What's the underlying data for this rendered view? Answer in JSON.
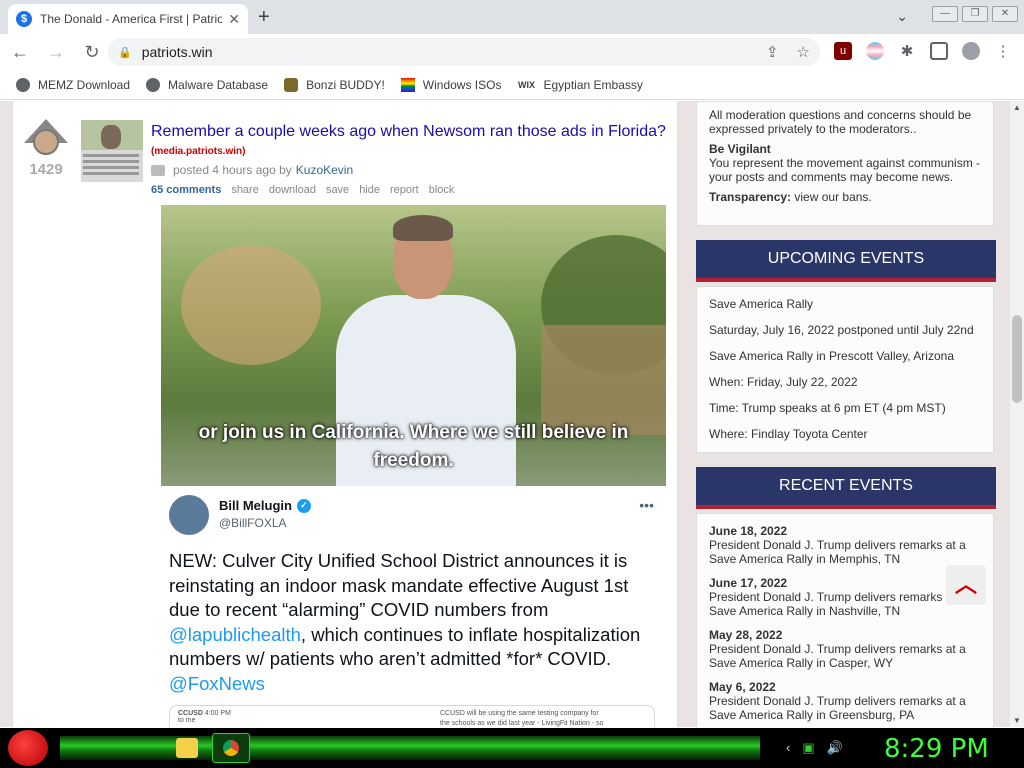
{
  "browser": {
    "tab_title": "The Donald - America First | Patriots",
    "favicon_glyph": "$",
    "close_glyph": "✕",
    "new_tab_glyph": "+",
    "url": "patriots.win"
  },
  "bookmarks": [
    {
      "label": "MEMZ Download"
    },
    {
      "label": "Malware Database"
    },
    {
      "label": "Bonzi BUDDY!"
    },
    {
      "label": "Windows ISOs"
    },
    {
      "label": "Egyptian Embassy",
      "icon_text": "WIX"
    }
  ],
  "post": {
    "score": "1429",
    "title": "Remember a couple weeks ago when Newsom ran those ads in Florida?",
    "domain": "(media.patriots.win)",
    "posted": "posted 4 hours ago by",
    "author": "KuzoKevin",
    "actions": {
      "comments": "65 comments",
      "share": "share",
      "download": "download",
      "save": "save",
      "hide": "hide",
      "report": "report",
      "block": "block"
    },
    "video_caption_1": "or join us in California. Where we still believe in",
    "video_caption_2": "freedom.",
    "tweet": {
      "name": "Bill Melugin",
      "handle": "@BillFOXLA",
      "text_1": "NEW: Culver City Unified School District announces it is reinstating an indoor mask mandate effective August 1st due to recent “alarming” COVID numbers from ",
      "link_1": "@lapublichealth",
      "text_2": ", which continues to inflate hospitalization numbers w/ patients who aren’t admitted *for* COVID. ",
      "link_2": "@FoxNews",
      "embed_sender": "CCUSD",
      "embed_time": "4:00 PM",
      "embed_to": "to me",
      "embed_line_1": "CCUSD will be using the same testing company for",
      "embed_line_2": "the schools as we did last year - LivingFit Nation - so"
    }
  },
  "sidebar": {
    "rules": {
      "moderation": "All moderation questions and concerns should be expressed privately to the moderators..",
      "vigilant_title": "Be Vigilant",
      "vigilant_text": "You represent the movement against communism - your posts and comments may become news.",
      "transparency_title": "Transparency:",
      "transparency_link": "view our bans."
    },
    "upcoming_title": "UPCOMING EVENTS",
    "upcoming": [
      "Save America Rally",
      "Saturday, July 16, 2022 postponed until July 22nd",
      "Save America Rally in Prescott Valley, Arizona",
      "When: Friday, July 22, 2022",
      "Time: Trump speaks at 6 pm ET (4 pm MST)",
      "Where: Findlay Toyota Center"
    ],
    "recent_title": "RECENT EVENTS",
    "recent": [
      {
        "date": "June 18, 2022",
        "text": "President Donald J. Trump delivers remarks at a Save America Rally in Memphis, TN"
      },
      {
        "date": "June 17, 2022",
        "text": "President Donald J. Trump delivers remarks at a Save America Rally in Nashville, TN"
      },
      {
        "date": "May 28, 2022",
        "text": "President Donald J. Trump delivers remarks at a Save America Rally in Casper, WY"
      },
      {
        "date": "May 6, 2022",
        "text": "President Donald J. Trump delivers remarks at a Save America Rally in Greensburg, PA"
      }
    ]
  },
  "taskbar": {
    "clock": "8:29 PM"
  },
  "colors": {
    "accent_navy": "#2b3668",
    "accent_red": "#b22234",
    "link": "#1a0dab",
    "clock_green": "#3cff3c"
  }
}
